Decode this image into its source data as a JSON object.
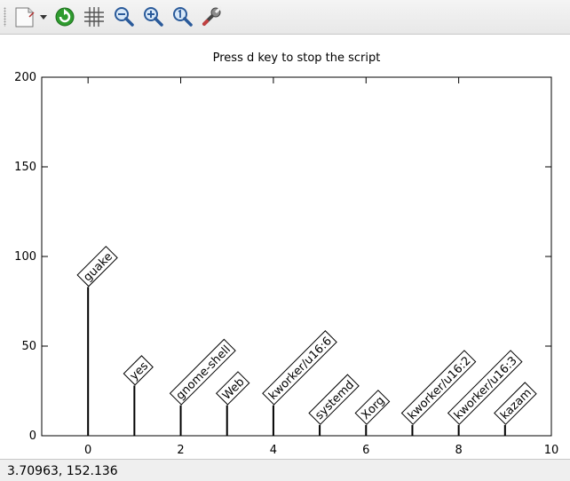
{
  "toolbar": {
    "items": [
      {
        "name": "export-menu-icon"
      },
      {
        "name": "replot-icon"
      },
      {
        "name": "grid-icon"
      },
      {
        "name": "zoom-out-icon"
      },
      {
        "name": "zoom-in-icon"
      },
      {
        "name": "zoom-reset-icon"
      },
      {
        "name": "settings-wrench-icon"
      }
    ]
  },
  "status": {
    "coords": "3.70963,  152.136"
  },
  "chart_data": {
    "type": "bar",
    "title": "Press d key to stop the script",
    "xlabel": "",
    "ylabel": "",
    "xlim": [
      -1,
      10
    ],
    "ylim": [
      0,
      200
    ],
    "xticks": [
      0,
      2,
      4,
      6,
      8,
      10
    ],
    "yticks": [
      0,
      50,
      100,
      150,
      200
    ],
    "grid": false,
    "x": [
      0,
      1,
      2,
      3,
      4,
      5,
      6,
      7,
      8,
      9
    ],
    "values": [
      83,
      28,
      17,
      17,
      17,
      6,
      6,
      6,
      6,
      6
    ],
    "labels": [
      "guake",
      "yes",
      "gnome-shell",
      "Web",
      "kworker/u16:6",
      "systemd",
      "Xorg",
      "kworker/u16:2",
      "kworker/u16:3",
      "kazam"
    ],
    "colors": {
      "bar": "#000000",
      "axis": "#000000"
    }
  }
}
